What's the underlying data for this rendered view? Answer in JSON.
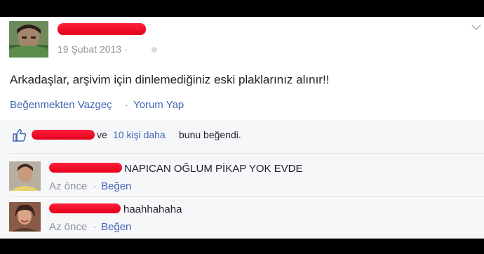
{
  "post": {
    "timestamp": "19 Şubat 2013 ·",
    "text": "Arkadaşlar, arşivim için dinlemediğiniz eski plaklarınız alınır!!",
    "actions": {
      "unlike": "Beğenmekten Vazgeç",
      "separator": "·",
      "comment": "Yorum Yap"
    }
  },
  "likes": {
    "prefix": "ve",
    "others_link": "10 kişi daha",
    "suffix": "bunu beğendi."
  },
  "comments": [
    {
      "text": "NAPICAN OĞLUM PİKAP YOK EVDE",
      "time": "Az önce",
      "separator": "·",
      "like": "Beğen"
    },
    {
      "text": "haahhahaha",
      "time": "Az önce",
      "separator": "·",
      "like": "Beğen"
    }
  ],
  "colors": {
    "link": "#4267b2",
    "redaction": "#e3001b",
    "text": "#1d2129",
    "meta": "#90949c"
  }
}
